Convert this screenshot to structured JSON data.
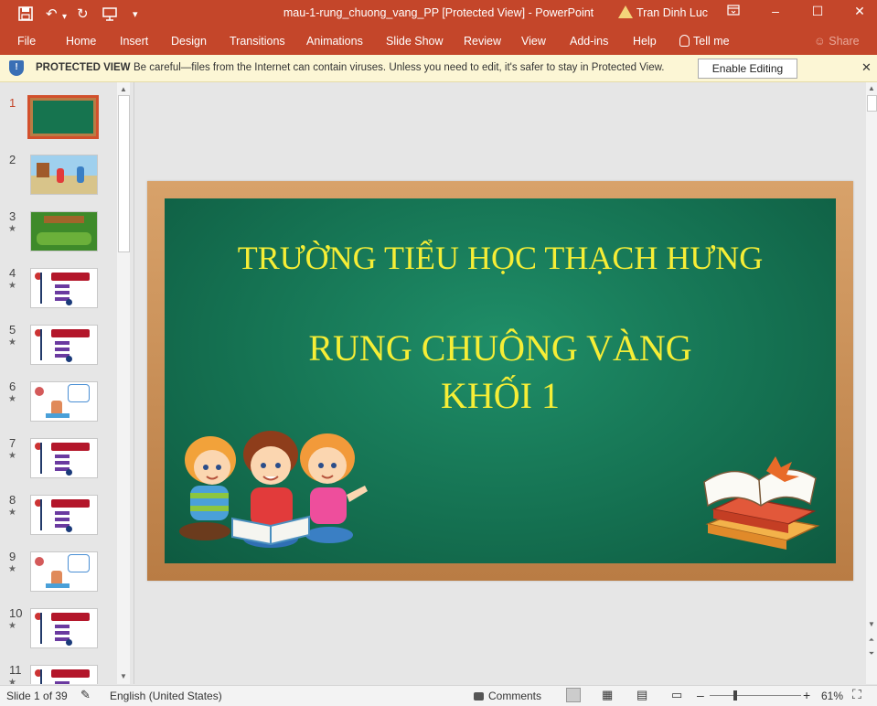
{
  "titlebar": {
    "doc_title": "mau-1-rung_chuong_vang_PP [Protected View]  -  PowerPoint",
    "user": "Tran Dinh Luc"
  },
  "ribbon": {
    "tabs": [
      "File",
      "Home",
      "Insert",
      "Design",
      "Transitions",
      "Animations",
      "Slide Show",
      "Review",
      "View",
      "Add-ins",
      "Help"
    ],
    "tell_me": "Tell me",
    "share": "Share"
  },
  "protected_view": {
    "label": "PROTECTED VIEW",
    "message": "Be careful—files from the Internet can contain viruses. Unless you need to edit, it's safer to stay in Protected View.",
    "enable_button": "Enable Editing"
  },
  "thumbnails": [
    {
      "num": "1",
      "star": false,
      "selected": true,
      "kind": "board"
    },
    {
      "num": "2",
      "star": false,
      "selected": false,
      "kind": "scene"
    },
    {
      "num": "3",
      "star": true,
      "selected": false,
      "kind": "forest"
    },
    {
      "num": "4",
      "star": true,
      "selected": false,
      "kind": "quiz"
    },
    {
      "num": "5",
      "star": true,
      "selected": false,
      "kind": "quiz"
    },
    {
      "num": "6",
      "star": true,
      "selected": false,
      "kind": "math"
    },
    {
      "num": "7",
      "star": true,
      "selected": false,
      "kind": "quiz"
    },
    {
      "num": "8",
      "star": true,
      "selected": false,
      "kind": "quiz"
    },
    {
      "num": "9",
      "star": true,
      "selected": false,
      "kind": "math"
    },
    {
      "num": "10",
      "star": true,
      "selected": false,
      "kind": "quiz"
    },
    {
      "num": "11",
      "star": true,
      "selected": false,
      "kind": "quiz"
    }
  ],
  "slide": {
    "line1": "TRƯỜNG TIỂU HỌC THẠCH HƯNG",
    "line2": "RUNG CHUÔNG VÀNG",
    "line3": "KHỐI 1"
  },
  "statusbar": {
    "slide_info": "Slide 1 of 39",
    "language": "English (United States)",
    "comments": "Comments",
    "zoom": "61%",
    "zoom_fraction": 0.61
  }
}
